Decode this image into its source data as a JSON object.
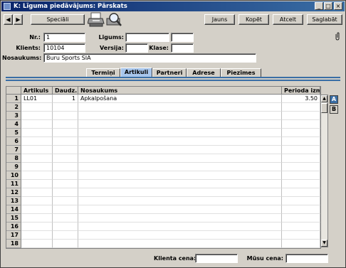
{
  "window": {
    "title": "K: Līguma piedāvājums: Pārskats"
  },
  "toolbar": {
    "nav_prev": "◀",
    "nav_next": "▶",
    "special": "Speciāli",
    "new": "Jauns",
    "copy": "Kopēt",
    "cancel": "Atcelt",
    "save": "Saglabāt"
  },
  "header": {
    "nr_label": "Nr.:",
    "nr_value": "1",
    "contract_label": "Līgums:",
    "contract_value": "",
    "contract_value2": "",
    "client_label": "Klients:",
    "client_value": "10104",
    "version_label": "Versija:",
    "version_value": "",
    "class_label": "Klase:",
    "class_value": "",
    "name_label": "Nosaukums:",
    "name_value": "Buru Sports SIA"
  },
  "tabs": [
    "Termiņi",
    "Artikuli",
    "Partneri",
    "Adrese",
    "Piezīmes"
  ],
  "active_tab": "Artikuli",
  "grid": {
    "columns": [
      "Artikuls",
      "Daudz.",
      "Nosaukums",
      "Perioda izm."
    ],
    "row_numbers": [
      "1",
      "2",
      "3",
      "4",
      "5",
      "6",
      "7",
      "8",
      "9",
      "10",
      "11",
      "12",
      "13",
      "14",
      "15",
      "16",
      "17",
      "18"
    ],
    "rows": [
      {
        "item": "LL01",
        "qty": "1",
        "name": "Apkalpošana",
        "price": "3.50"
      }
    ]
  },
  "side_tabs": [
    "A",
    "B"
  ],
  "footer": {
    "client_price_label": "Klienta cena:",
    "client_price_value": "",
    "our_price_label": "Mūsu cena:",
    "our_price_value": ""
  },
  "colors": {
    "titlebar": "#0a246a",
    "active_tab": "#a8c6ec",
    "accent_line": "#3a6ea5"
  }
}
